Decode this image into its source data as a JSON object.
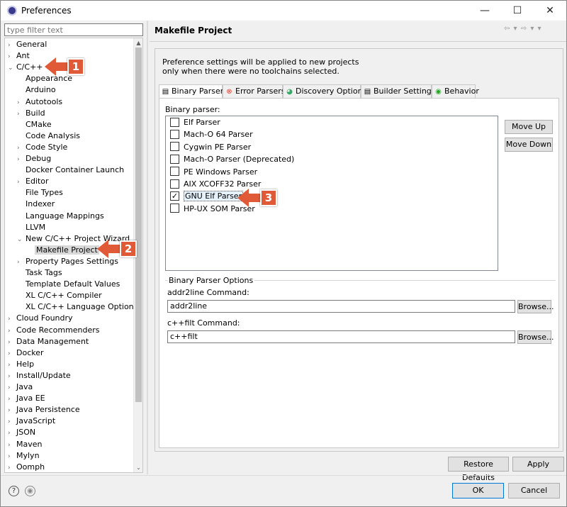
{
  "window": {
    "title": "Preferences",
    "controls": {
      "minimize": "—",
      "maximize": "☐",
      "close": "✕"
    }
  },
  "filter": {
    "placeholder": "type filter text"
  },
  "tree": {
    "items": [
      {
        "label": "General",
        "chevron": "›"
      },
      {
        "label": "Ant",
        "chevron": "›"
      },
      {
        "label": "C/C++",
        "chevron": "⌄"
      },
      {
        "label": "Appearance",
        "chevron": ""
      },
      {
        "label": "Arduino",
        "chevron": ""
      },
      {
        "label": "Autotools",
        "chevron": "›"
      },
      {
        "label": "Build",
        "chevron": "›"
      },
      {
        "label": "CMake",
        "chevron": ""
      },
      {
        "label": "Code Analysis",
        "chevron": ""
      },
      {
        "label": "Code Style",
        "chevron": "›"
      },
      {
        "label": "Debug",
        "chevron": "›"
      },
      {
        "label": "Docker Container Launch",
        "chevron": ""
      },
      {
        "label": "Editor",
        "chevron": "›"
      },
      {
        "label": "File Types",
        "chevron": ""
      },
      {
        "label": "Indexer",
        "chevron": ""
      },
      {
        "label": "Language Mappings",
        "chevron": ""
      },
      {
        "label": "LLVM",
        "chevron": ""
      },
      {
        "label": "New C/C++ Project Wizard",
        "chevron": "⌄"
      },
      {
        "label": "Makefile Project",
        "chevron": ""
      },
      {
        "label": "Property Pages Settings",
        "chevron": "›"
      },
      {
        "label": "Task Tags",
        "chevron": ""
      },
      {
        "label": "Template Default Values",
        "chevron": ""
      },
      {
        "label": "XL C/C++ Compiler",
        "chevron": ""
      },
      {
        "label": "XL C/C++ Language Options",
        "chevron": ""
      },
      {
        "label": "Cloud Foundry",
        "chevron": "›"
      },
      {
        "label": "Code Recommenders",
        "chevron": "›"
      },
      {
        "label": "Data Management",
        "chevron": "›"
      },
      {
        "label": "Docker",
        "chevron": "›"
      },
      {
        "label": "Help",
        "chevron": "›"
      },
      {
        "label": "Install/Update",
        "chevron": "›"
      },
      {
        "label": "Java",
        "chevron": "›"
      },
      {
        "label": "Java EE",
        "chevron": "›"
      },
      {
        "label": "Java Persistence",
        "chevron": "›"
      },
      {
        "label": "JavaScript",
        "chevron": "›"
      },
      {
        "label": "JSON",
        "chevron": "›"
      },
      {
        "label": "Maven",
        "chevron": "›"
      },
      {
        "label": "Mylyn",
        "chevron": "›"
      },
      {
        "label": "Oomph",
        "chevron": "›"
      }
    ],
    "scroll": {
      "up": "▲",
      "down": "⌄"
    }
  },
  "page": {
    "title": "Makefile Project",
    "nav": "⇦ ▾ ⇨ ▾ ▾",
    "info_line1": "Preference settings will be applied to new projects",
    "info_line2": "only when there were no toolchains selected."
  },
  "tabs": [
    {
      "label": "Binary Parsers",
      "icon": "▤"
    },
    {
      "label": "Error Parsers",
      "icon": "⊗"
    },
    {
      "label": "Discovery Options",
      "icon": "◕"
    },
    {
      "label": "Builder Settings",
      "icon": "▤"
    },
    {
      "label": "Behavior",
      "icon": "◉"
    }
  ],
  "binary_parser": {
    "label": "Binary parser:",
    "items": [
      {
        "label": "Elf Parser",
        "checked": ""
      },
      {
        "label": "Mach-O 64 Parser",
        "checked": ""
      },
      {
        "label": "Cygwin PE Parser",
        "checked": ""
      },
      {
        "label": "Mach-O Parser (Deprecated)",
        "checked": ""
      },
      {
        "label": "PE Windows Parser",
        "checked": ""
      },
      {
        "label": "AIX XCOFF32 Parser",
        "checked": ""
      },
      {
        "label": "GNU Elf Parser",
        "checked": "✓"
      },
      {
        "label": "HP-UX SOM Parser",
        "checked": ""
      }
    ],
    "move_up": "Move Up",
    "move_down": "Move Down"
  },
  "options": {
    "title": "Binary Parser Options",
    "addr2line_label": "addr2line Command:",
    "addr2line_value": "addr2line",
    "cppfilt_label": "c++filt Command:",
    "cppfilt_value": "c++filt",
    "browse": "Browse..."
  },
  "buttons": {
    "restore_defaults": "Restore Defaults",
    "apply": "Apply",
    "ok": "OK",
    "cancel": "Cancel"
  },
  "footer": {
    "help_icon": "?",
    "record_icon": "◉"
  },
  "callouts": [
    "1",
    "2",
    "3"
  ],
  "colors": {
    "callout": "#e05a38"
  }
}
